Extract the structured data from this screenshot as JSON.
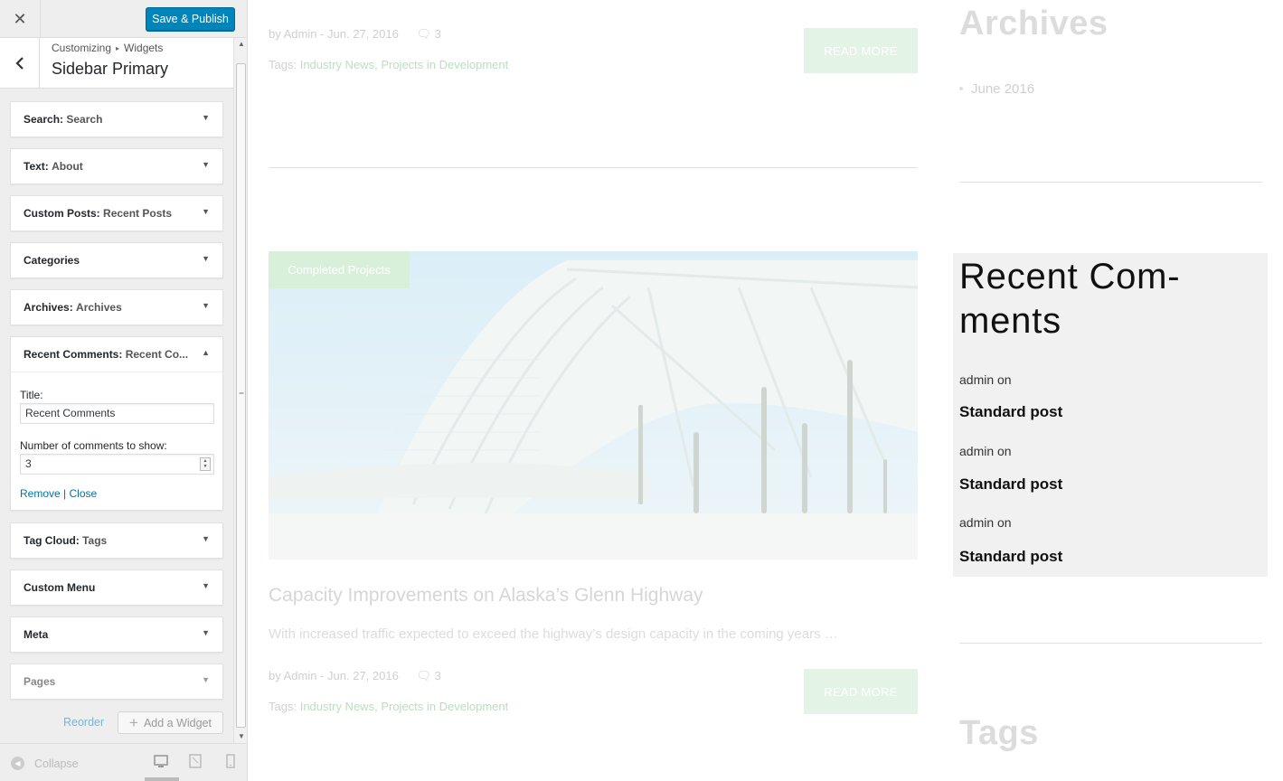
{
  "panel": {
    "close_icon": "close-icon",
    "save_label": "Save & Publish",
    "breadcrumb": {
      "root": "Customizing",
      "child": "Widgets"
    },
    "section_title": "Sidebar Primary",
    "widgets": [
      {
        "type": "Search:",
        "name": "Search"
      },
      {
        "type": "Text:",
        "name": "About"
      },
      {
        "type": "Custom Posts:",
        "name": "Recent Posts"
      },
      {
        "type": "Categories",
        "name": ""
      },
      {
        "type": "Archives:",
        "name": "Archives"
      },
      {
        "type": "Recent Comments:",
        "name": "Recent Co..."
      },
      {
        "type": "Tag Cloud:",
        "name": "Tags"
      },
      {
        "type": "Custom Menu",
        "name": ""
      },
      {
        "type": "Meta",
        "name": ""
      },
      {
        "type": "Pages",
        "name": ""
      }
    ],
    "recent_comments_form": {
      "title_label": "Title:",
      "title_value": "Recent Comments",
      "number_label": "Number of comments to show:",
      "number_value": "3",
      "remove_label": "Remove",
      "separator": "|",
      "close_label": "Close"
    },
    "reorder_label": "Reorder",
    "add_widget_label": "Add a Widget",
    "collapse_label": "Collapse",
    "active_device": "desktop"
  },
  "preview": {
    "post1": {
      "meta": "by Admin - Jun. 27, 2016",
      "comments": "3",
      "tags_label": "Tags:",
      "tag1": "Industry News",
      "tag_sep": ",",
      "tag2": "Projects in Development",
      "read_more": "READ MORE"
    },
    "post2": {
      "category": "Completed Projects",
      "title": "Capacity Improvements on Alaska’s Glenn Highway",
      "excerpt": "With increased traffic expected to exceed the highway’s design capacity in the coming years …",
      "meta": "by Admin - Jun. 27, 2016",
      "comments": "3",
      "tags_label": "Tags:",
      "tag1": "Industry News",
      "tag_sep": ",",
      "tag2": "Projects in Development",
      "read_more": "READ MORE"
    },
    "sidebar": {
      "archives_title": "Archives",
      "archives_item": "June 2016",
      "recent_comments_title": "Recent Com- ments",
      "comments": [
        {
          "author": "admin on",
          "post": "Standard post"
        },
        {
          "author": "admin on",
          "post": "Standard post"
        },
        {
          "author": "admin on",
          "post": "Standard post"
        }
      ],
      "tags_title": "Tags"
    }
  },
  "colors": {
    "primary_button": "#0085ba",
    "link": "#0073aa",
    "read_more_bg": "#e3f3e6",
    "recent_comments_bg": "#f1f1f1"
  }
}
